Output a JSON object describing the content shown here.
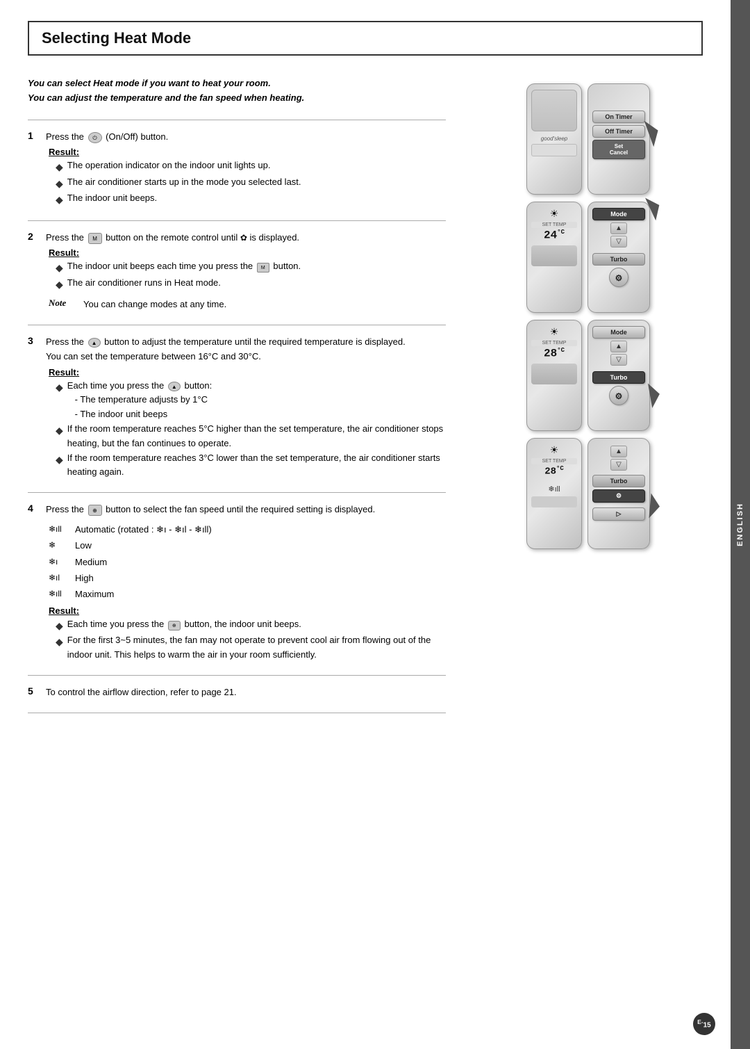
{
  "page": {
    "title": "Selecting Heat Mode",
    "side_tab": "ENGLISH",
    "page_number": "E-15"
  },
  "intro": {
    "line1": "You can select Heat mode if you want to heat your room.",
    "line2": "You can adjust the temperature and the fan speed when heating."
  },
  "steps": [
    {
      "num": "1",
      "text": "Press the  (On/Off) button.",
      "result_label": "Result:",
      "result_items": [
        "The operation indicator on the indoor unit lights up.",
        "The air conditioner starts up in the mode you selected last.",
        "The indoor unit beeps."
      ]
    },
    {
      "num": "2",
      "text": "Press the  button on the remote control until  is displayed.",
      "result_label": "Result:",
      "result_items": [
        "The indoor unit beeps each time you press the  button.",
        "The air conditioner runs in Heat mode."
      ],
      "note_label": "Note",
      "note_text": "You can change modes at any time."
    },
    {
      "num": "3",
      "text": "Press the  button to adjust the temperature until the required temperature is displayed.",
      "sub_text": "You can set the temperature between 16°C and 30°C.",
      "result_label": "Result:",
      "result_items": [
        "Each time you press the  button:\n- The temperature adjusts by 1°C\n- The indoor unit beeps",
        "If the room temperature reaches 5°C higher than the set temperature, the air conditioner stops heating, but the fan continues to operate.",
        "If the room temperature reaches 3°C lower than the set temperature, the air conditioner starts heating again."
      ]
    },
    {
      "num": "4",
      "text": "Press the  button to select the fan speed until the required setting is displayed.",
      "fan_speeds": [
        {
          "icon": "❄̈ıl",
          "label": "Automatic (rotated : ❄̈ı - ❄̈ıl - ❄̈ıll)"
        },
        {
          "icon": "❄̈",
          "label": "Low"
        },
        {
          "icon": "❄̈ı",
          "label": "Medium"
        },
        {
          "icon": "❄̈ıl",
          "label": "High"
        },
        {
          "icon": "❄̈ıll",
          "label": "Maximum"
        }
      ],
      "result_label": "Result:",
      "result_items": [
        "Each time you press the  button, the indoor unit beeps.",
        "For the first 3~5 minutes, the fan may not operate to prevent cool air from flowing out of the indoor unit. This helps to warm the air in your room sufficiently."
      ]
    },
    {
      "num": "5",
      "text": "To control the airflow direction, refer to page 21."
    }
  ],
  "remote_panels": [
    {
      "id": "panel1",
      "left_display": "good'sleep",
      "buttons_right": [
        "On Timer",
        "Off Timer",
        "Set\nCancel"
      ],
      "highlight": "Set Cancel"
    },
    {
      "id": "panel2",
      "temp": "24°C",
      "buttons_right": [
        "Mode",
        "▲",
        "▽",
        "Turbo",
        "⚙"
      ],
      "highlight": "Mode"
    },
    {
      "id": "panel3",
      "temp": "28°C",
      "buttons_right": [
        "Mode",
        "▲",
        "▽",
        "Turbo",
        "⚙"
      ],
      "highlight": "Turbo"
    },
    {
      "id": "panel4",
      "temp": "28°C",
      "buttons_right": [
        "▲",
        "▽",
        "Turbo",
        "⚙",
        "▷"
      ],
      "highlight": "fan"
    }
  ]
}
